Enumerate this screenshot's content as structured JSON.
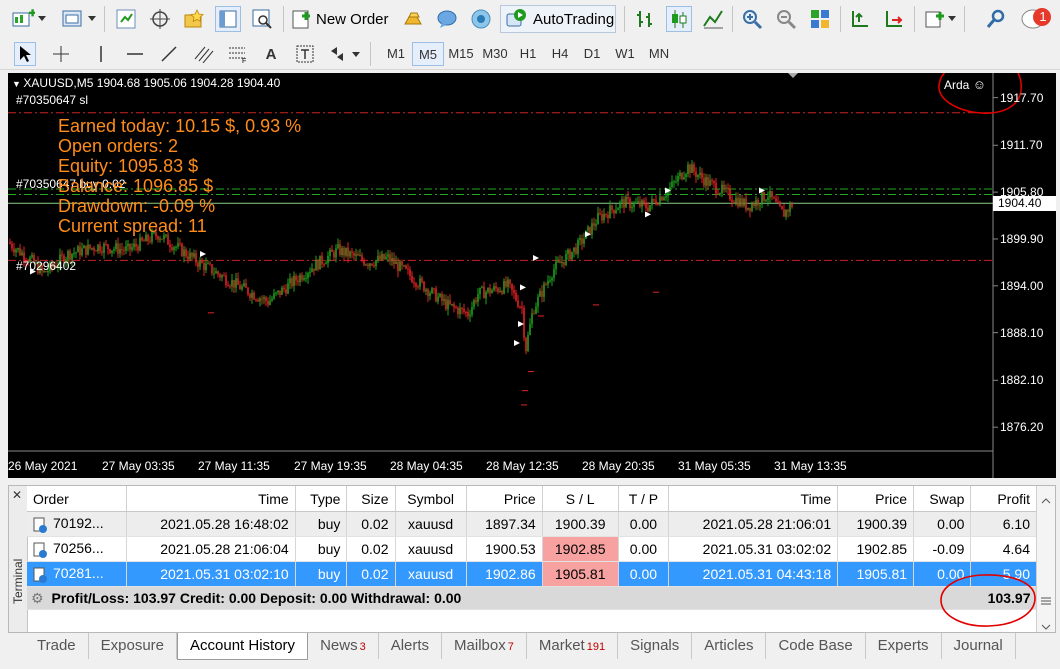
{
  "toolbar": {
    "new_order_label": "New Order",
    "autotrading_label": "AutoTrading",
    "notification_count": "1"
  },
  "timeframes": [
    "M1",
    "M5",
    "M15",
    "M30",
    "H1",
    "H4",
    "D1",
    "W1",
    "MN"
  ],
  "active_timeframe": "M5",
  "chart": {
    "header": "XAUUSD,M5  1904.68 1905.06 1904.28 1904.40",
    "ea_name": "Arda",
    "sl_label": "#70350647 sl",
    "overlap_label": "#70350647 buy 0.02",
    "order_label_2": "#70296402",
    "current_price": "1904.40",
    "price_ticks": [
      "1917.70",
      "1911.70",
      "1905.80",
      "1899.90",
      "1894.00",
      "1888.10",
      "1882.10",
      "1876.20"
    ],
    "time_ticks": [
      "26 May 2021",
      "27 May 03:35",
      "27 May 11:35",
      "27 May 19:35",
      "28 May 04:35",
      "28 May 12:35",
      "28 May 20:35",
      "31 May 05:35",
      "31 May 13:35"
    ],
    "stats": [
      "Earned today: 10.15 $, 0.93 %",
      "Open orders: 2",
      "Equity: 1095.83 $",
      "Balance: 1096.85 $",
      "Drawdown: -0.09 %",
      "Current spread: 11"
    ]
  },
  "chart_data": {
    "type": "candlestick",
    "symbol": "XAUUSD",
    "timeframe": "M5",
    "ylim": [
      1873.2,
      1920.8
    ],
    "ohlc_last": {
      "open": 1904.68,
      "high": 1905.06,
      "low": 1904.28,
      "close": 1904.4
    },
    "anchor_path": [
      [
        0,
        1899.5
      ],
      [
        25,
        1897.0
      ],
      [
        35,
        1895.5
      ],
      [
        60,
        1898.0
      ],
      [
        90,
        1899.0
      ],
      [
        120,
        1898.5
      ],
      [
        150,
        1900.5
      ],
      [
        190,
        1897.0
      ],
      [
        230,
        1894.0
      ],
      [
        260,
        1892.0
      ],
      [
        300,
        1896.0
      ],
      [
        330,
        1898.5
      ],
      [
        360,
        1897.0
      ],
      [
        380,
        1897.5
      ],
      [
        410,
        1894.5
      ],
      [
        440,
        1891.5
      ],
      [
        460,
        1890.5
      ],
      [
        470,
        1893.0
      ],
      [
        500,
        1894.0
      ],
      [
        515,
        1891.0
      ],
      [
        517,
        1885.5
      ],
      [
        525,
        1891.0
      ],
      [
        545,
        1896.0
      ],
      [
        570,
        1899.0
      ],
      [
        590,
        1902.5
      ],
      [
        615,
        1904.5
      ],
      [
        640,
        1904.0
      ],
      [
        660,
        1906.0
      ],
      [
        680,
        1909.0
      ],
      [
        700,
        1907.0
      ],
      [
        720,
        1905.5
      ],
      [
        740,
        1904.0
      ],
      [
        760,
        1905.5
      ],
      [
        775,
        1903.0
      ],
      [
        785,
        1904.4
      ]
    ],
    "horizontal_lines": [
      {
        "price": 1915.8,
        "color": "#cc2222",
        "style": "dash-dot",
        "label": "#70350647 sl"
      },
      {
        "price": 1906.2,
        "color": "#22aa22",
        "style": "dash-dot"
      },
      {
        "price": 1905.5,
        "color": "#22aa22",
        "style": "dash-dot",
        "label": "#70350647 buy 0.02"
      },
      {
        "price": 1904.4,
        "color": "#88cc88",
        "style": "solid"
      },
      {
        "price": 1897.2,
        "color": "#cc2222",
        "style": "dash-dot",
        "label": "#70296402"
      }
    ],
    "colors": {
      "up": "#1fa31f",
      "down": "#e52222",
      "background": "#000000"
    }
  },
  "terminal": {
    "side_label": "Terminal",
    "columns": [
      "Order",
      "Time",
      "Type",
      "Size",
      "Symbol",
      "Price",
      "S / L",
      "T / P",
      "Time",
      "Price",
      "Swap",
      "Profit"
    ],
    "rows": [
      [
        "70192...",
        "2021.05.28 16:48:02",
        "buy",
        "0.02",
        "xauusd",
        "1897.34",
        "1900.39",
        "0.00",
        "2021.05.28 21:06:01",
        "1900.39",
        "0.00",
        "6.10"
      ],
      [
        "70256...",
        "2021.05.28 21:06:04",
        "buy",
        "0.02",
        "xauusd",
        "1900.53",
        "1902.85",
        "0.00",
        "2021.05.31 03:02:02",
        "1902.85",
        "-0.09",
        "4.64"
      ],
      [
        "70281...",
        "2021.05.31 03:02:10",
        "buy",
        "0.02",
        "xauusd",
        "1902.86",
        "1905.81",
        "0.00",
        "2021.05.31 04:43:18",
        "1905.81",
        "0.00",
        "5.90"
      ]
    ],
    "selected_row": 2,
    "summary": "Profit/Loss: 103.97  Credit: 0.00  Deposit: 0.00  Withdrawal: 0.00",
    "total_profit": "103.97"
  },
  "tabs": [
    {
      "label": "Trade",
      "badge": ""
    },
    {
      "label": "Exposure",
      "badge": ""
    },
    {
      "label": "Account History",
      "badge": ""
    },
    {
      "label": "News",
      "badge": "3"
    },
    {
      "label": "Alerts",
      "badge": ""
    },
    {
      "label": "Mailbox",
      "badge": "7"
    },
    {
      "label": "Market",
      "badge": "191"
    },
    {
      "label": "Signals",
      "badge": ""
    },
    {
      "label": "Articles",
      "badge": ""
    },
    {
      "label": "Code Base",
      "badge": ""
    },
    {
      "label": "Experts",
      "badge": ""
    },
    {
      "label": "Journal",
      "badge": ""
    }
  ],
  "active_tab": "Account History",
  "annotation_color": "#e00000"
}
